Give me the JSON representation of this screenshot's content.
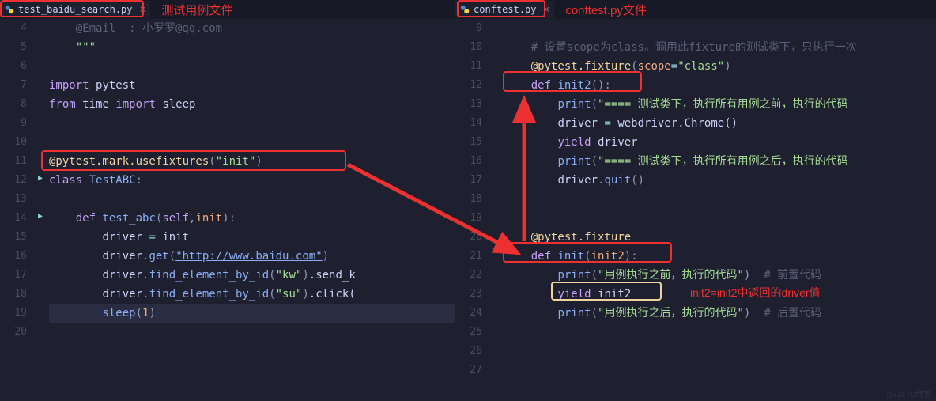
{
  "left": {
    "tab": {
      "filename": "test_baidu_search.py",
      "annotation": "测试用例文件"
    },
    "lines": [
      4,
      5,
      6,
      7,
      8,
      9,
      10,
      11,
      12,
      13,
      14,
      15,
      16,
      17,
      18,
      19,
      20
    ],
    "code": {
      "c4": "    @Email  : 小罗罗@qq.com",
      "c5": "    \"\"\"",
      "c7_import": "import",
      "c7_mod": "pytest",
      "c8_from": "from",
      "c8_mod": "time",
      "c8_import": "import",
      "c8_name": "sleep",
      "c11_decor": "@pytest.mark.usefixtures",
      "c11_arg": "\"init\"",
      "c12_class": "class",
      "c12_name": "TestABC",
      "c14_def": "def",
      "c14_name": "test_abc",
      "c14_p1": "self",
      "c14_p2": "init",
      "c15_lhs": "driver",
      "c15_rhs": "init",
      "c16_obj": "driver",
      "c16_call": "get",
      "c16_arg": "\"http://www.baidu.com\"",
      "c17_obj": "driver",
      "c17_call": "find_element_by_id",
      "c17_arg": "\"kw\"",
      "c17_tail": ".send_k",
      "c18_obj": "driver",
      "c18_call": "find_element_by_id",
      "c18_arg": "\"su\"",
      "c18_tail": ".click(",
      "c19_fn": "sleep",
      "c19_arg": "1"
    }
  },
  "right": {
    "tab": {
      "filename": "conftest.py",
      "annotation": "conftest.py文件"
    },
    "lines": [
      9,
      10,
      11,
      12,
      13,
      14,
      15,
      16,
      17,
      18,
      19,
      20,
      21,
      22,
      23,
      24,
      25,
      26,
      27
    ],
    "code": {
      "c10_cmt": "# 设置scope为class。调用此fixture的测试类下，只执行一次",
      "c11_decor": "@pytest.fixture",
      "c11_kw": "scope",
      "c11_val": "\"class\"",
      "c12_def": "def",
      "c12_name": "init2",
      "c13_fn": "print",
      "c13_arg": "\"==== 测试类下，执行所有用例之前，执行的代码",
      "c14_lhs": "driver",
      "c14_rhs": "webdriver.Chrome()",
      "c15_yield": "yield",
      "c15_val": "driver",
      "c16_fn": "print",
      "c16_arg": "\"==== 测试类下，执行所有用例之后，执行的代码",
      "c17_obj": "driver",
      "c17_call": "quit",
      "c20_decor": "@pytest.fixture",
      "c21_def": "def",
      "c21_name": "init",
      "c21_param": "init2",
      "c22_fn": "print",
      "c22_arg": "\"用例执行之前，执行的代码\"",
      "c22_cmt": "# 前置代码",
      "c23_yield": "yield",
      "c23_val": "init2",
      "c23_note": "init2=init2中返回的driver值",
      "c24_fn": "print",
      "c24_arg": "\"用例执行之后，执行的代码\"",
      "c24_cmt": "# 后置代码"
    }
  },
  "watermark": "@51CTO博客"
}
